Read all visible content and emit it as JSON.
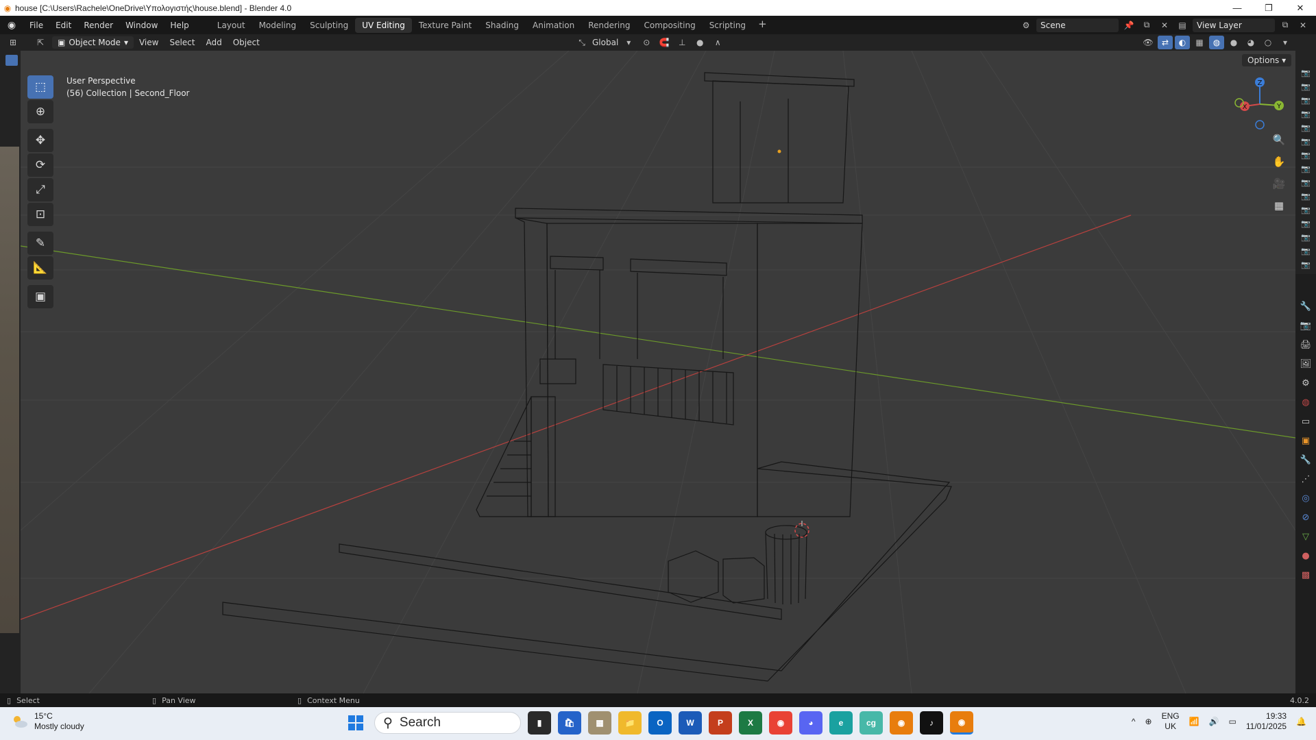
{
  "window": {
    "title": "house [C:\\Users\\Rachele\\OneDrive\\Υπολογιστής\\house.blend] - Blender 4.0",
    "icon": "blender-logo-icon",
    "controls": [
      "minimize-icon",
      "maximize-icon",
      "close-icon"
    ]
  },
  "menubar": {
    "items": [
      "File",
      "Edit",
      "Render",
      "Window",
      "Help"
    ],
    "workspaces": [
      "Layout",
      "Modeling",
      "Sculpting",
      "UV Editing",
      "Texture Paint",
      "Shading",
      "Animation",
      "Rendering",
      "Compositing",
      "Scripting"
    ],
    "active_workspace": "UV Editing",
    "add_workspace": "+",
    "scene": "Scene",
    "view_layer": "View Layer"
  },
  "header": {
    "mode": "Object Mode",
    "menus": [
      "View",
      "Select",
      "Add",
      "Object"
    ],
    "transform_orientation": "Global",
    "options_label": "Options"
  },
  "viewport": {
    "perspective_label": "User Perspective",
    "collection_label": "(56) Collection | Second_Floor",
    "gizmo_axes": [
      "X",
      "Y",
      "Z"
    ]
  },
  "statusbar": {
    "select": "Select",
    "pan_view": "Pan View",
    "context_menu": "Context Menu",
    "version": "4.0.2"
  },
  "taskbar": {
    "temperature": "15°C",
    "weather": "Mostly cloudy",
    "search_placeholder": "Search",
    "language_line1": "ENG",
    "language_line2": "UK",
    "time": "19:33",
    "date": "11/01/2025"
  },
  "colors": {
    "accent": "#4772b3",
    "x_axis": "#b8413e",
    "y_axis": "#6c9a2a",
    "blender_orange": "#e87d0d"
  }
}
